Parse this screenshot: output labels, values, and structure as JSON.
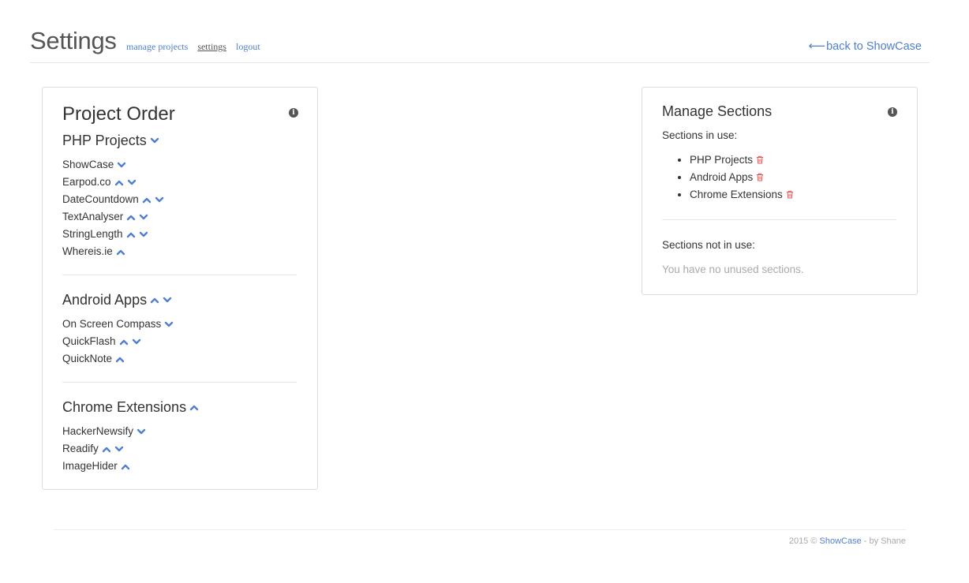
{
  "header": {
    "title": "Settings",
    "nav": [
      "manage projects",
      "settings",
      "logout"
    ],
    "back_link": "back to ShowCase",
    "back_arrow": "⟵"
  },
  "project_order": {
    "title": "Project Order",
    "sections": [
      {
        "name": "PHP Projects",
        "arrows": [
          "down"
        ],
        "projects": [
          {
            "name": "ShowCase",
            "arrows": [
              "down"
            ]
          },
          {
            "name": "Earpod.co",
            "arrows": [
              "up",
              "down"
            ]
          },
          {
            "name": "DateCountdown",
            "arrows": [
              "up",
              "down"
            ]
          },
          {
            "name": "TextAnalyser",
            "arrows": [
              "up",
              "down"
            ]
          },
          {
            "name": "StringLength",
            "arrows": [
              "up",
              "down"
            ]
          },
          {
            "name": "Whereis.ie",
            "arrows": [
              "up"
            ]
          }
        ]
      },
      {
        "name": "Android Apps",
        "arrows": [
          "up",
          "down"
        ],
        "projects": [
          {
            "name": "On Screen Compass",
            "arrows": [
              "down"
            ]
          },
          {
            "name": "QuickFlash",
            "arrows": [
              "up",
              "down"
            ]
          },
          {
            "name": "QuickNote",
            "arrows": [
              "up"
            ]
          }
        ]
      },
      {
        "name": "Chrome Extensions",
        "arrows": [
          "up"
        ],
        "projects": [
          {
            "name": "HackerNewsify",
            "arrows": [
              "down"
            ]
          },
          {
            "name": "Readify",
            "arrows": [
              "up",
              "down"
            ]
          },
          {
            "name": "ImageHider",
            "arrows": [
              "up"
            ]
          }
        ]
      }
    ]
  },
  "manage_sections": {
    "title": "Manage Sections",
    "in_use_label": "Sections in use:",
    "in_use": [
      "PHP Projects",
      "Android Apps",
      "Chrome Extensions"
    ],
    "not_in_use_label": "Sections not in use:",
    "empty_text": "You have no unused sections."
  },
  "footer": {
    "year": "2015 ©",
    "app": "ShowCase",
    "by": "- by Shane"
  },
  "colors": {
    "link": "#4f7fd0",
    "trash": "#e05a5a",
    "text": "#333333",
    "muted": "#aaaaaa"
  },
  "icons": {
    "arrow_up": "chevron-up-icon",
    "arrow_down": "chevron-down-icon",
    "info": "info-icon",
    "trash": "trash-icon"
  }
}
